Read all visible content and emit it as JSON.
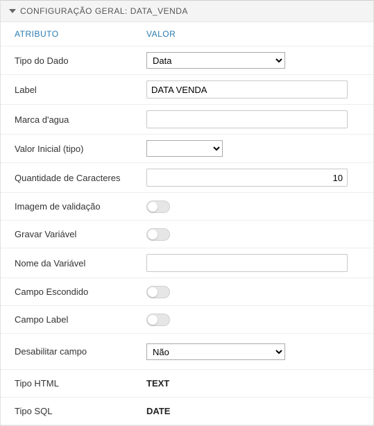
{
  "header": {
    "title": "CONFIGURAÇÃO GERAL: DATA_VENDA"
  },
  "columns": {
    "attribute": "ATRIBUTO",
    "value": "VALOR"
  },
  "rows": {
    "data_type": {
      "label": "Tipo do Dado",
      "value": "Data"
    },
    "label_field": {
      "label": "Label",
      "value": "DATA VENDA"
    },
    "watermark": {
      "label": "Marca d'agua",
      "value": ""
    },
    "initial_value": {
      "label": "Valor Inicial (tipo)",
      "value": ""
    },
    "char_qty": {
      "label": "Quantidade de Caracteres",
      "value": "10"
    },
    "validation_img": {
      "label": "Imagem de validação"
    },
    "save_var": {
      "label": "Gravar Variável"
    },
    "var_name": {
      "label": "Nome da Variável",
      "value": ""
    },
    "hidden_field": {
      "label": "Campo Escondido"
    },
    "label_field_toggle": {
      "label": "Campo Label"
    },
    "disable_field": {
      "label": "Desabilitar campo",
      "value": "Não"
    },
    "html_type": {
      "label": "Tipo HTML",
      "value": "TEXT"
    },
    "sql_type": {
      "label": "Tipo SQL",
      "value": "DATE"
    }
  }
}
